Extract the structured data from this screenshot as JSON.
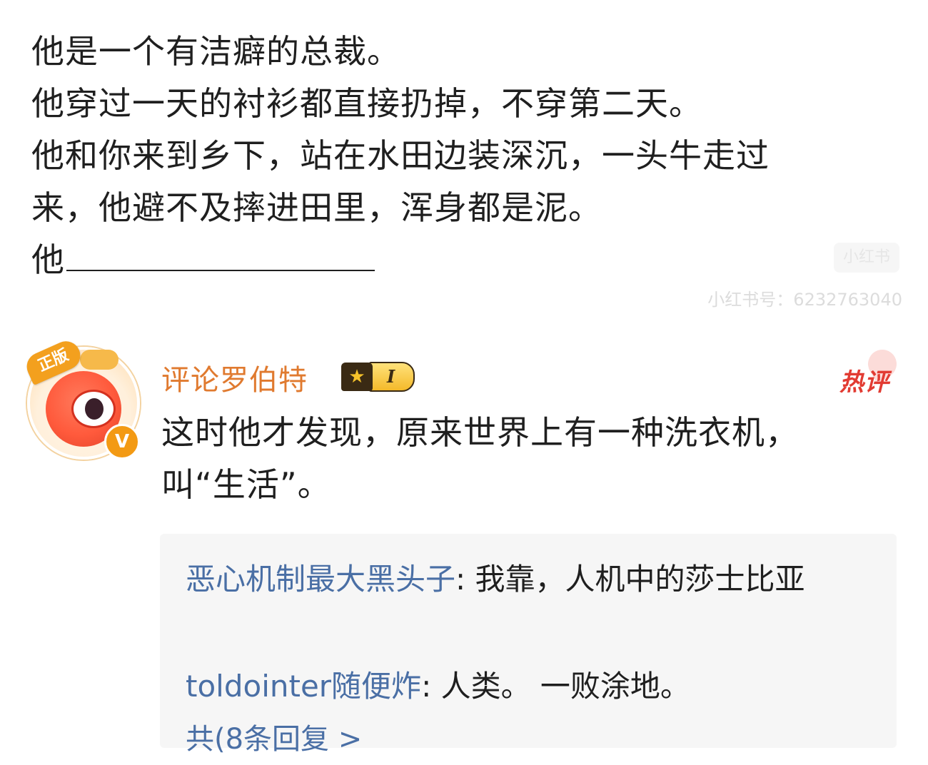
{
  "post": {
    "lines": [
      "他是一个有洁癖的总裁。",
      "他穿过一天的衬衫都直接扔掉，不穿第二天。",
      "他和你来到乡下，站在水田边装深沉，一头牛走过",
      "来，他避不及摔进田里，浑身都是泥。",
      "他"
    ]
  },
  "watermark": {
    "logo": "小红书",
    "id": "小红书号：6232763040"
  },
  "comment": {
    "avatar_badge": "正版",
    "avatar_verified": "V",
    "username": "评论罗伯特",
    "level": "I",
    "hot_label": "热评",
    "text": "这时他才发现，原来世界上有一种洗衣机，叫“生活”。"
  },
  "replies": [
    {
      "user": "恶心机制最大黑头子",
      "text": "我靠，人机中的莎士比亚"
    },
    {
      "user": "toldointer随便炸",
      "text": "人类。 一败涂地。"
    }
  ],
  "more_replies": "共(8条回复 >",
  "colors": {
    "username": "#e07a2f",
    "reply_user": "#4a6fa5",
    "hot": "#e23b32"
  }
}
